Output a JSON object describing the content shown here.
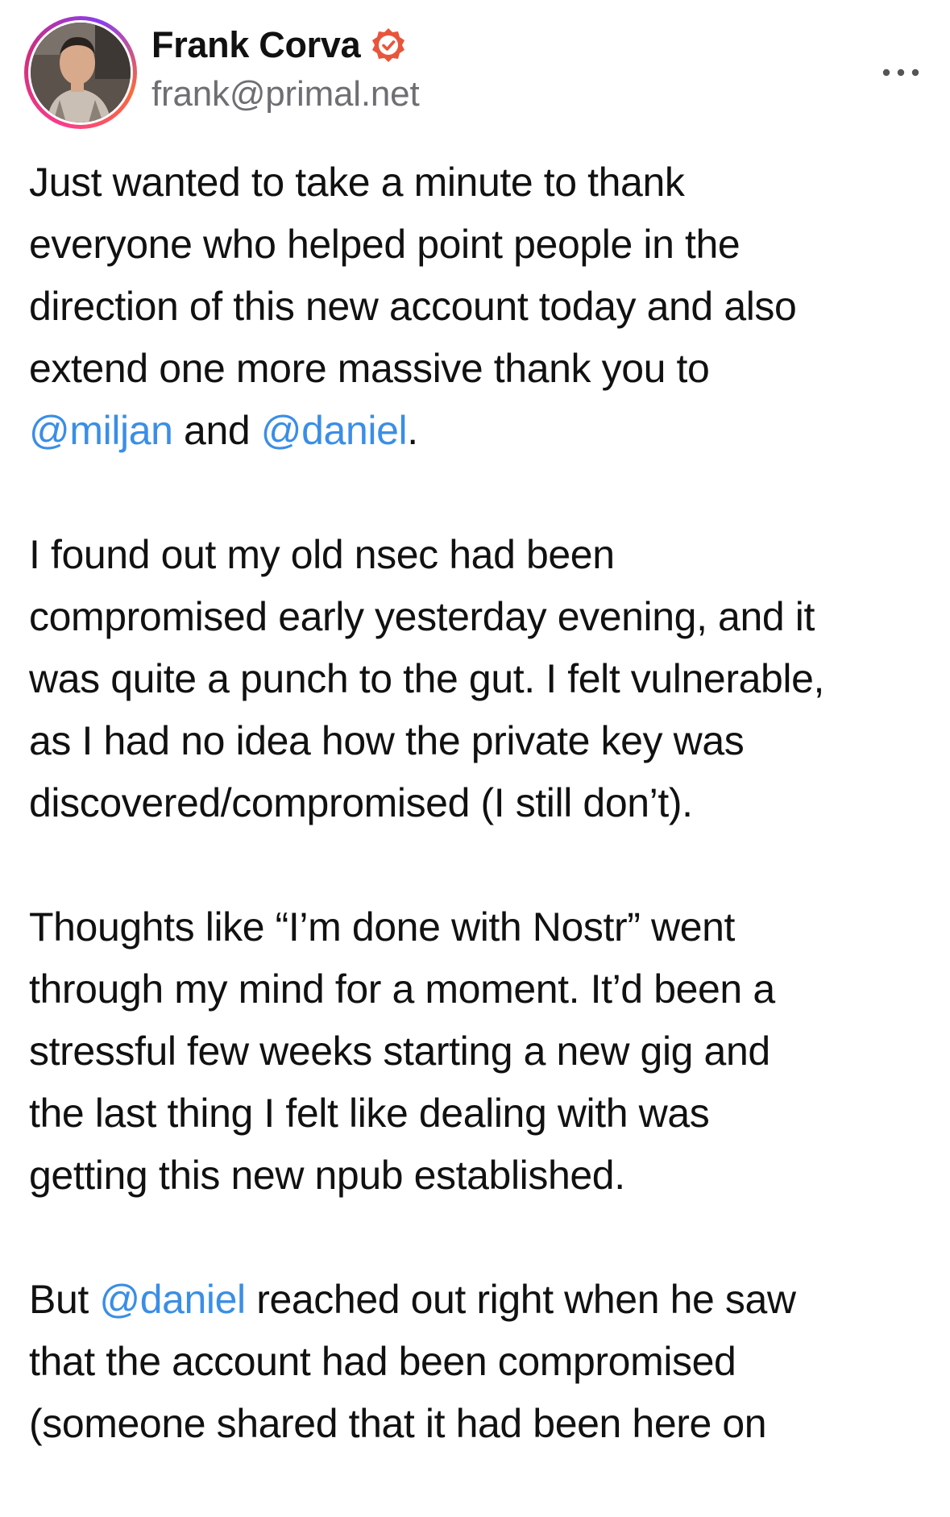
{
  "author": {
    "display_name": "Frank Corva",
    "handle": "frank@primal.net",
    "verified_badge_color": "#e8553b"
  },
  "menu": {
    "more_icon": "ellipsis-icon"
  },
  "post": {
    "p1": {
      "l1": "Just wanted to take a minute to thank",
      "l2": "everyone who helped point people in the",
      "l3": "direction of this new account today and also",
      "l4": "extend one more massive thank you to",
      "mention_1": "@miljan",
      "between": " and ",
      "mention_2": "@daniel",
      "end": "."
    },
    "p2": {
      "l1": "I found out my old nsec had been",
      "l2": "compromised early yesterday evening, and it",
      "l3": "was quite a punch to the gut. I felt vulnerable,",
      "l4": "as I had no idea how the private key was",
      "l5": "discovered/compromised (I still don’t)."
    },
    "p3": {
      "l1": "Thoughts like “I’m done with Nostr” went",
      "l2": "through my mind for a moment. It’d been a",
      "l3": "stressful few weeks starting a new gig and",
      "l4": "the last thing I felt like dealing with was",
      "l5": "getting this new npub established."
    },
    "p4": {
      "start": "But ",
      "mention": "@daniel",
      "l1_rest": " reached out right when he saw",
      "l2": "that the account had been compromised",
      "l3": "(someone shared that it had been here on"
    }
  },
  "colors": {
    "mention": "#3a8ee6",
    "handle": "#6e6e73",
    "text": "#111111"
  }
}
